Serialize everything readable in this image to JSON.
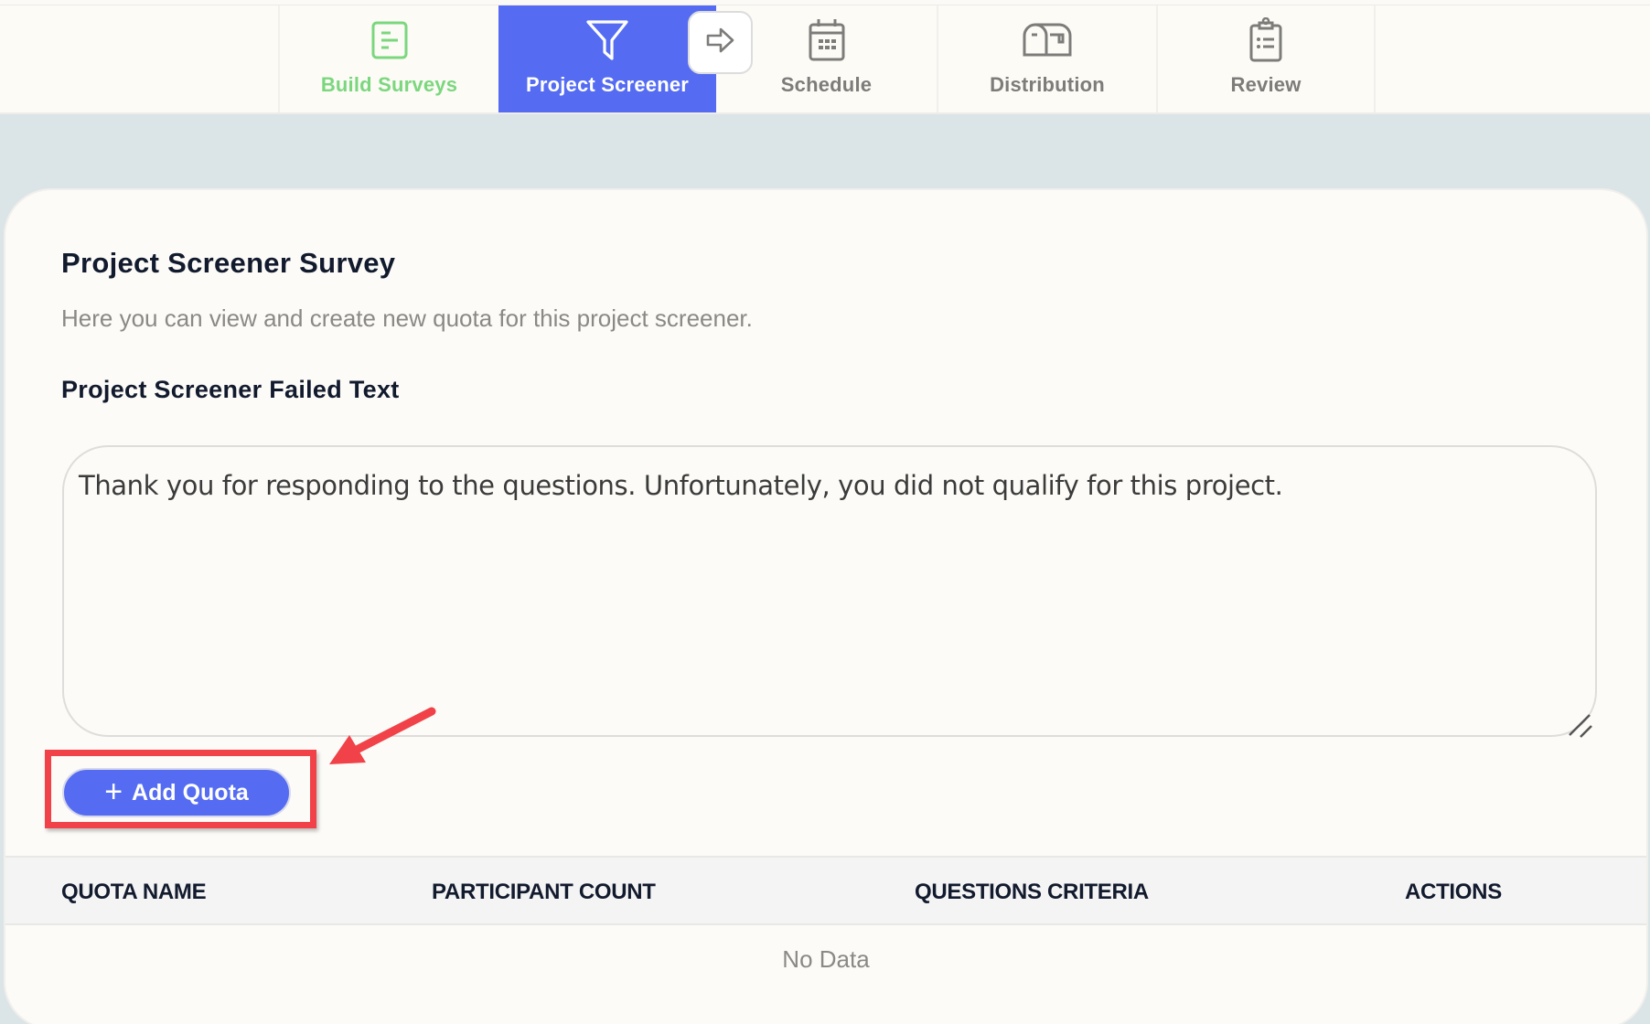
{
  "tabs": [
    {
      "label": "Build Surveys",
      "icon": "document-lines-icon",
      "state": "done"
    },
    {
      "label": "Project Screener",
      "icon": "funnel-icon",
      "state": "active"
    },
    {
      "label": "Schedule",
      "icon": "calendar-icon",
      "state": "pending"
    },
    {
      "label": "Distribution",
      "icon": "mailbox-icon",
      "state": "pending"
    },
    {
      "label": "Review",
      "icon": "clipboard-list-icon",
      "state": "pending"
    }
  ],
  "next_step_button": {
    "icon": "arrow-right-icon"
  },
  "card": {
    "title": "Project Screener Survey",
    "subtitle": "Here you can view and create new quota for this project screener.",
    "failed_text_label": "Project Screener Failed Text",
    "failed_text_value": "Thank you for responding to the questions. Unfortunately, you did not qualify for this project.",
    "add_quota_label": "Add Quota",
    "add_quota_icon": "+"
  },
  "table": {
    "columns": [
      "QUOTA NAME",
      "PARTICIPANT COUNT",
      "QUESTIONS CRITERIA",
      "ACTIONS"
    ],
    "rows": [],
    "empty_text": "No Data"
  },
  "colors": {
    "accent": "#556cf2",
    "done": "#7bd77e",
    "annotation": "#f04248",
    "background": "#dbe5e7"
  }
}
